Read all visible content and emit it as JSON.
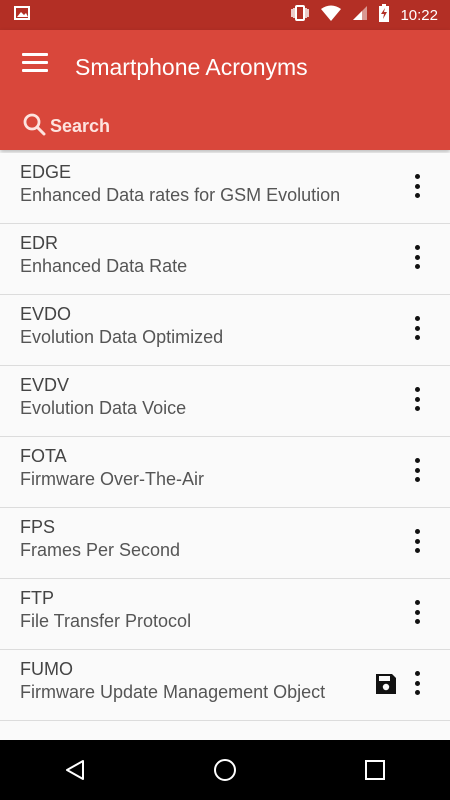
{
  "status": {
    "time": "10:22"
  },
  "appbar": {
    "title": "Smartphone Acronyms",
    "search_label": "Search"
  },
  "items": [
    {
      "acronym": "EDGE",
      "meaning": "Enhanced Data rates for GSM Evolution"
    },
    {
      "acronym": "EDR",
      "meaning": "Enhanced Data Rate"
    },
    {
      "acronym": "EVDO",
      "meaning": "Evolution Data Optimized"
    },
    {
      "acronym": "EVDV",
      "meaning": "Evolution Data Voice"
    },
    {
      "acronym": "FOTA",
      "meaning": "Firmware Over-The-Air"
    },
    {
      "acronym": "FPS",
      "meaning": "Frames Per Second"
    },
    {
      "acronym": "FTP",
      "meaning": "File Transfer Protocol"
    },
    {
      "acronym": "FUMO",
      "meaning": "Firmware Update Management Object"
    }
  ],
  "colors": {
    "statusbar": "#b32f25",
    "appbar": "#d9473b"
  }
}
